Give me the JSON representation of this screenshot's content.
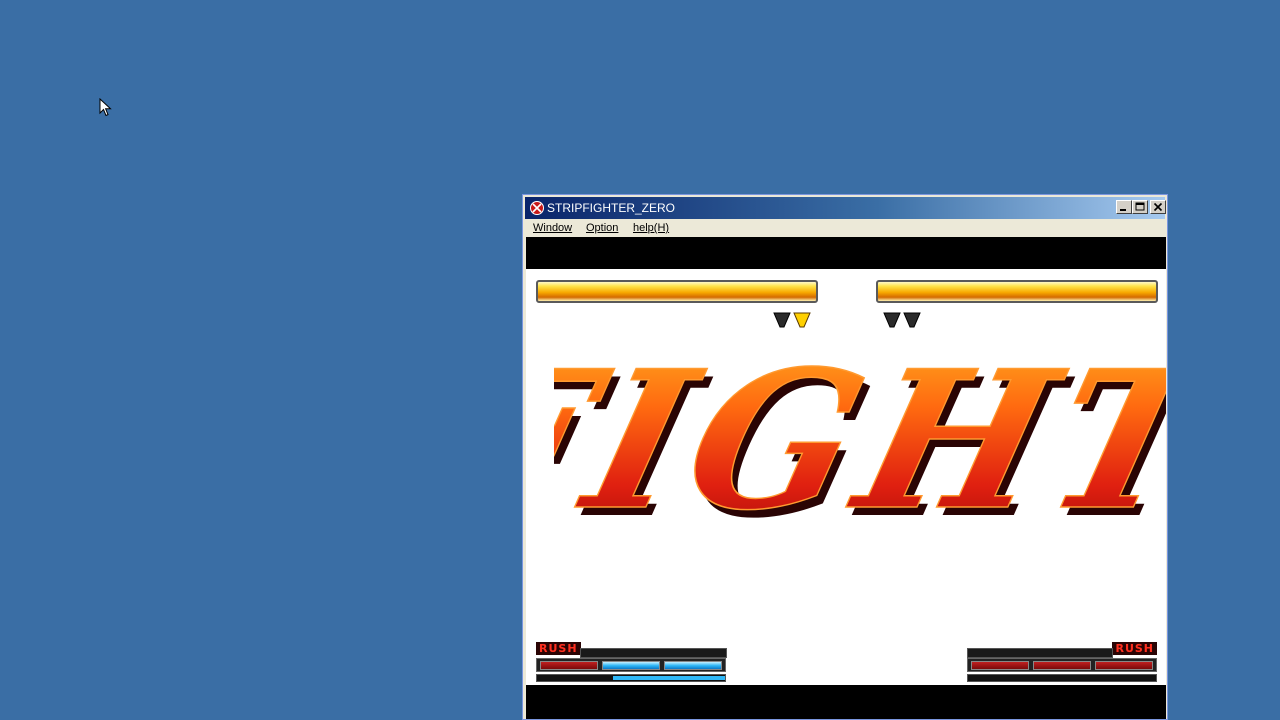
{
  "window": {
    "title": "STRIPFIGHTER_ZERO"
  },
  "menu": {
    "items": [
      "Window",
      "Option",
      "help(H)"
    ]
  },
  "game": {
    "banner": "FIGHT",
    "player1": {
      "health": 1.0,
      "rounds_won": 1,
      "rush_label": "RUSH",
      "gauge_fill": 0.6,
      "cells": [
        "red",
        "blue",
        "blue"
      ]
    },
    "player2": {
      "health": 1.0,
      "rounds_won": 0,
      "rush_label": "RUSH",
      "gauge_fill": 0.0,
      "cells": [
        "red",
        "red",
        "red"
      ]
    }
  },
  "colors": {
    "desktop": "#3a6ea5",
    "fight_orange": "#ff8a10",
    "fight_red": "#e02010",
    "gauge_blue": "#2fb8f8"
  }
}
